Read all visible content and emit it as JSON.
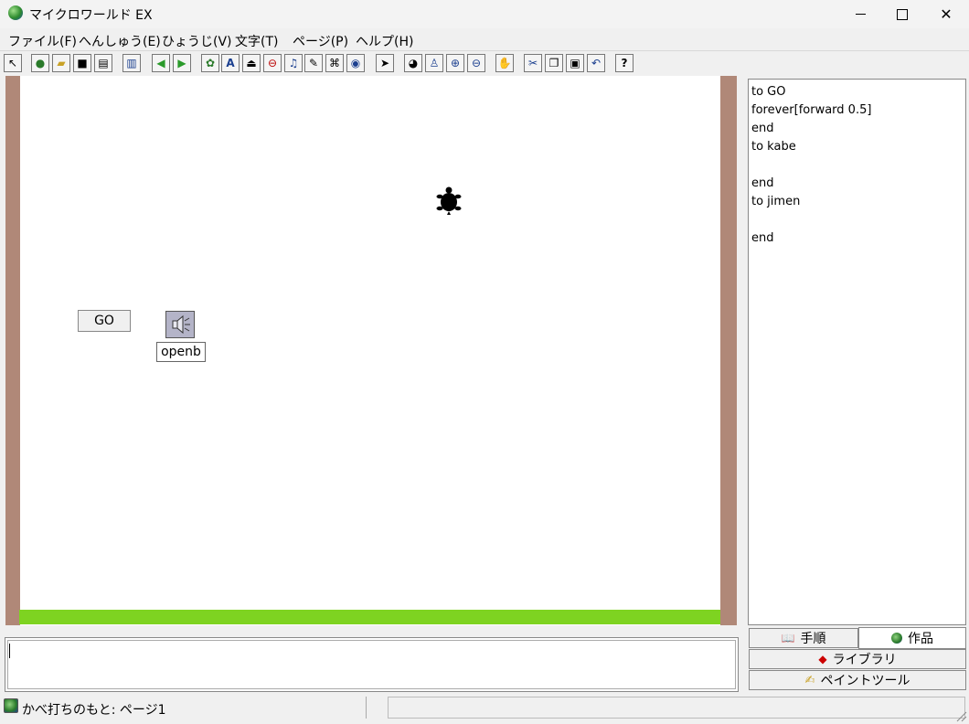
{
  "window": {
    "title": "マイクロワールド EX"
  },
  "menu": [
    {
      "label": "ファイル(F)"
    },
    {
      "label": "へんしゅう(E)"
    },
    {
      "label": "ひょうじ(V)"
    },
    {
      "label": "文字(T)"
    },
    {
      "label": "ページ(P)"
    },
    {
      "label": "ヘルプ(H)"
    }
  ],
  "toolbar": {
    "icons": [
      "pointer-arrow-icon",
      "new-project-icon",
      "open-folder-icon",
      "save-disk-icon",
      "print-icon",
      "columns-icon",
      "prev-page-icon",
      "next-page-icon",
      "hatch-turtle-icon",
      "text-box-icon",
      "button-icon",
      "slider-icon",
      "music-icon",
      "draw-icon",
      "video-icon",
      "record-icon",
      "select-arrow-icon",
      "eye-icon",
      "stamp-icon",
      "zoom-in-icon",
      "zoom-out-icon",
      "stop-hand-icon",
      "cut-icon",
      "copy-icon",
      "paste-icon",
      "undo-icon",
      "help-icon"
    ]
  },
  "stage": {
    "go_button_label": "GO",
    "speaker_label": "openb",
    "colors": {
      "wall": "#b08878",
      "ground": "#7ed321",
      "turtle": "#000000"
    }
  },
  "procedures": {
    "text": "to GO\nforever[forward 0.5]\nend\nto kabe\n\nend\nto jimen\n\nend"
  },
  "tabs": {
    "procedures": "手順",
    "projects": "作品",
    "library": "ライブラリ",
    "paint": "ペイントツール"
  },
  "command_center": {
    "value": ""
  },
  "status": {
    "text": "かべ打ちのもと: ページ1"
  }
}
